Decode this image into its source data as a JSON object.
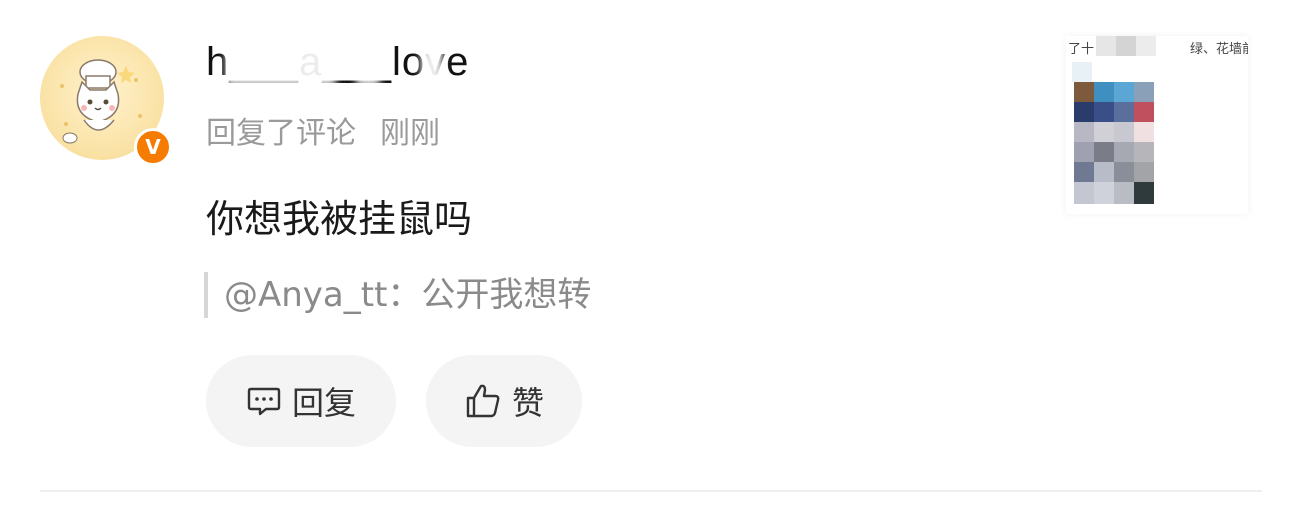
{
  "user": {
    "name": "h___a___love",
    "avatar_icon": "cat-chef-avatar",
    "verified_badge": "V",
    "badge_color": "#f57c00"
  },
  "meta": {
    "action": "回复了评论",
    "time": "刚刚"
  },
  "comment": {
    "text": "你想我被挂鼠吗"
  },
  "quote": {
    "text": "@Anya_tt：公开我想转"
  },
  "actions": {
    "reply_label": "回复",
    "reply_icon": "comment-icon",
    "like_label": "赞",
    "like_icon": "thumbs-up-icon"
  },
  "thumbnail": {
    "caption_left": "了十",
    "caption_right": "绿、花墙前"
  }
}
